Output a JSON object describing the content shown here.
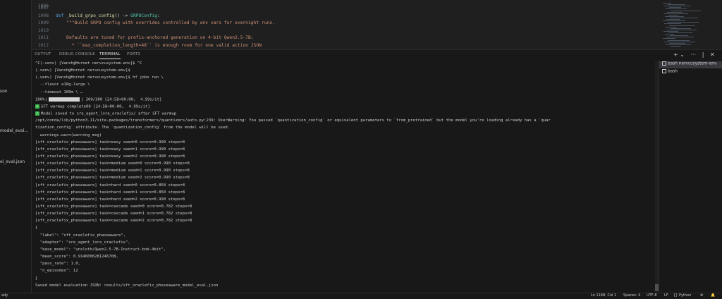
{
  "explorer": {
    "items": [
      "son",
      "model_eval...",
      "el_eval.json"
    ]
  },
  "editor": {
    "lines": [
      {
        "num": "1007",
        "parts": []
      },
      {
        "num": "1008",
        "parts": [
          {
            "t": "def ",
            "c": "kw"
          },
          {
            "t": "_build_grpo_config",
            "c": "fn"
          },
          {
            "t": "() -> ",
            "c": ""
          },
          {
            "t": "GRPOConfig",
            "c": "ty"
          },
          {
            "t": ":",
            "c": ""
          }
        ]
      },
      {
        "num": "1009",
        "parts": [
          {
            "t": "    \"\"\"Build GRPO config with overrides controlled by env vars for overnight runs.",
            "c": "str"
          }
        ]
      },
      {
        "num": "1010",
        "parts": []
      },
      {
        "num": "1011",
        "parts": [
          {
            "t": "    Defaults are tuned for prefix-anchored generation on 4-bit Qwen2.5-7B:",
            "c": "str"
          }
        ]
      },
      {
        "num": "1012",
        "parts": [
          {
            "t": "      * ``max_completion_length=48`` is enough room for one valid action JSON",
            "c": "str"
          }
        ]
      }
    ],
    "first_num": "1006"
  },
  "panel": {
    "tabs": [
      "OUTPUT",
      "DEBUG CONSOLE",
      "TERMINAL",
      "PORTS"
    ],
    "active_tab": 2,
    "actions": [
      "+ ⌄",
      "···",
      "|",
      "✕"
    ]
  },
  "terminal": {
    "lines": [
      "^C(.venv) [Vansh@Hornet nervcusystem-env]$ ^C",
      "(.venv) [Vansh@Hornet nervcusystem-env]$",
      "(.venv) [Vansh@Hornet nervcusystem-env]$ hf jobs run \\",
      "  --flavor a10g-large \\",
      "  --timeout 100m \\ …",
      "__PROGRESS__",
      "✅ SFT warmup complete00 [24:58<00:00,  4.99s/it]",
      "✅ Model saved to sre_agent_lora_oraclefix/ after SFT warmup",
      "/opt/conda/lib/python3.11/site-packages/transformers/quantizers/auto.py:239: UserWarning: You passed `quantization_config` or equivalent parameters to `from_pretrained` but the model you're loading already has a `quar",
      "tization_config` attribute. The `quantization_config` from the model will be used.",
      "  warnings.warn(warning_msg)",
      "[sft_oraclefix_phaseaware] task=easy seed=0 score=0.990 steps=8",
      "[sft_oraclefix_phaseaware] task=easy seed=1 score=0.990 steps=8",
      "[sft_oraclefix_phaseaware] task=easy seed=2 score=0.990 steps=8",
      "[sft_oraclefix_phaseaware] task=medium seed=0 score=0.990 steps=8",
      "[sft_oraclefix_phaseaware] task=medium seed=1 score=0.990 steps=8",
      "[sft_oraclefix_phaseaware] task=medium seed=2 score=0.990 steps=8",
      "[sft_oraclefix_phaseaware] task=hard seed=0 score=0.850 steps=8",
      "[sft_oraclefix_phaseaware] task=hard seed=1 score=0.850 steps=8",
      "[sft_oraclefix_phaseaware] task=hard seed=2 score=0.990 steps=8",
      "[sft_oraclefix_phaseaware] task=cascade seed=0 score=0.782 steps=8",
      "[sft_oraclefix_phaseaware] task=cascade seed=1 score=0.782 steps=8",
      "[sft_oraclefix_phaseaware] task=cascade seed=2 score=0.782 steps=8",
      "{",
      "  \"label\": \"sft_oraclefix_phaseaware\",",
      "  \"adapter\": \"sre_agent_lora_oraclefix\",",
      "  \"base_model\": \"unsloth/Qwen2.5-7B-Instruct-bnb-4bit\",",
      "  \"mean_score\": 0.9146006281246708,",
      "  \"pass_rate\": 1.0,",
      "  \"n_episodes\": 12",
      "}",
      "Saved model evaluation JSON: results/sft_oraclefix_phaseaware_model_eval.json"
    ],
    "progress": {
      "left": "100%|",
      "right": "| 300/300 [24:58<00:00,  4.99s/it]"
    }
  },
  "terminal_list": {
    "items": [
      {
        "label": "bash  nervcusystem-env",
        "selected": true
      },
      {
        "label": "bash",
        "selected": false
      }
    ]
  },
  "statusbar": {
    "left": "ady",
    "right": [
      "Ln 1168, Col 1",
      "Spaces: 4",
      "UTF-8",
      "LF",
      "{} Python",
      "⚙",
      "🔔"
    ]
  }
}
